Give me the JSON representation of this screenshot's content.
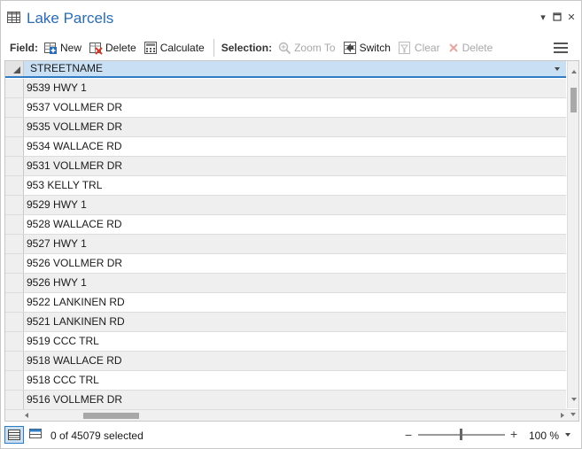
{
  "window": {
    "title": "Lake Parcels",
    "title_icon": "table-icon",
    "pin_icon": "dropdown-arrow-icon",
    "maximize_icon": "maximize-icon",
    "close_icon": "close-icon"
  },
  "toolbar": {
    "field_label": "Field:",
    "new_label": "New",
    "delete_label": "Delete",
    "calculate_label": "Calculate",
    "selection_label": "Selection:",
    "zoom_to_label": "Zoom To",
    "switch_label": "Switch",
    "clear_label": "Clear",
    "sel_delete_label": "Delete",
    "menu_icon": "hamburger-menu-icon"
  },
  "table": {
    "column": "STREETNAME",
    "rows": [
      "9539 HWY 1",
      "9537 VOLLMER DR",
      "9535 VOLLMER DR",
      "9534 WALLACE RD",
      "9531 VOLLMER DR",
      "953 KELLY TRL",
      "9529 HWY 1",
      "9528 WALLACE RD",
      "9527 HWY 1",
      "9526 VOLLMER DR",
      "9526 HWY 1",
      "9522 LANKINEN RD",
      "9521 LANKINEN RD",
      "9519 CCC TRL",
      "9518 WALLACE RD",
      "9518 CCC TRL",
      "9516 VOLLMER DR"
    ]
  },
  "status": {
    "selection_text": "0 of 45079 selected",
    "zoom_minus": "−",
    "zoom_plus": "+",
    "zoom_level": "100 %"
  },
  "colors": {
    "title_blue": "#2b6cb0",
    "header_bg": "#c9dff4",
    "header_underline": "#2f7bc4",
    "row_alt": "#efefef",
    "disabled_text": "#a8a8a8"
  }
}
